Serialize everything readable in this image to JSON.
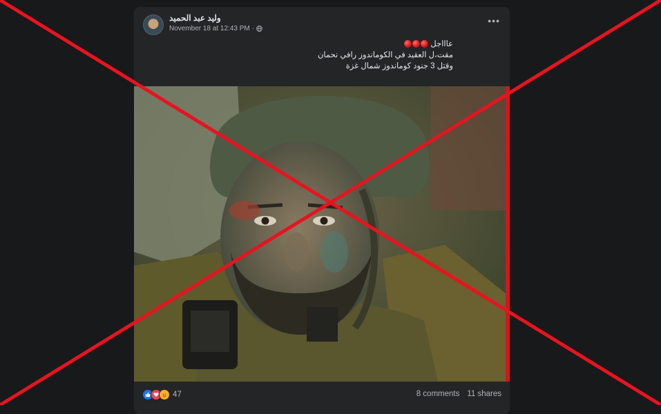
{
  "post": {
    "author": "وليد عبد الحميد",
    "timestamp": "November 18 at 12:43 PM",
    "separator": "·",
    "lines": [
      "عاااجل",
      "مقت،ل العقيد في الكوماندوز رافي نحمان",
      "وقتل 3 جنود كوماندوز شمال غزة"
    ],
    "urgent_dots": 3
  },
  "footer": {
    "reactions_count": "47",
    "comments": "8 comments",
    "shares": "11 shares"
  },
  "icons": {
    "avatar": "profile-photo",
    "privacy": "globe-icon",
    "more": "more-options-icon",
    "reactions": [
      "like-icon",
      "love-icon",
      "care-icon"
    ]
  },
  "colors": {
    "background": "#18191a",
    "card": "#242526",
    "text_primary": "#e4e6eb",
    "text_secondary": "#b0b3b8",
    "overlay_cross": "#e8131f"
  }
}
